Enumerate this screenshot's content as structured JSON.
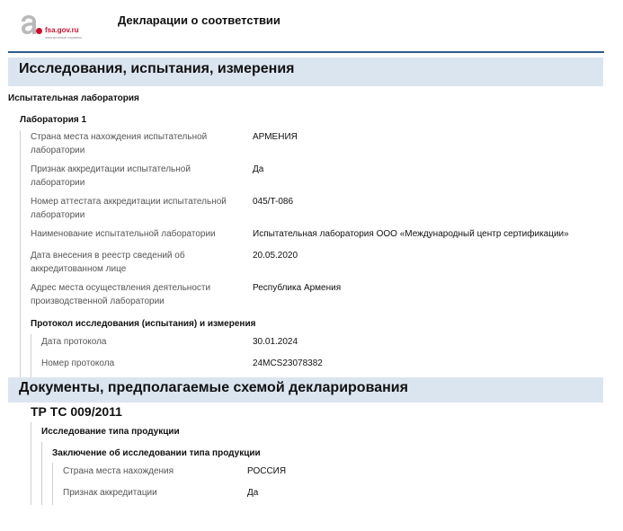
{
  "header": {
    "logo_text": "fsa.gov.ru",
    "logo_subtext": "электронные сервисы",
    "title": "Декларации о соответствии"
  },
  "research": {
    "section_title": "Исследования, испытания, измерения",
    "lab_heading": "Испытательная лаборатория",
    "lab_name": "Лаборатория 1",
    "fields": [
      {
        "label": "Страна места нахождения испытательной лаборатории",
        "value": "АРМЕНИЯ"
      },
      {
        "label": "Признак аккредитации испытательной лаборатории",
        "value": "Да"
      },
      {
        "label": "Номер аттестата аккредитации испытательной лаборатории",
        "value": "045/T-086"
      },
      {
        "label": "Наименование испытательной лаборатории",
        "value": "Испытательная лаборатория ООО «Международный центр сертификации»"
      },
      {
        "label": "Дата внесения в реестр сведений об аккредитованном лице",
        "value": "20.05.2020"
      },
      {
        "label": "Адрес места осуществления деятельности производственной лаборатории",
        "value": "Республика Армения"
      }
    ],
    "protocol_heading": "Протокол исследования (испытания) и измерения",
    "protocol_fields": [
      {
        "label": "Дата протокола",
        "value": "30.01.2024"
      },
      {
        "label": "Номер протокола",
        "value": "24MCS23078382"
      }
    ]
  },
  "documents": {
    "section_title": "Документы, предполагаемые схемой декларирования",
    "regulation": "ТР ТС 009/2011",
    "study_heading": "Исследование типа продукции",
    "conclusion_heading": "Заключение об исследовании типа продукции",
    "fields": [
      {
        "label": "Страна места нахождения",
        "value": "РОССИЯ"
      },
      {
        "label": "Признак аккредитации",
        "value": "Да"
      }
    ]
  }
}
